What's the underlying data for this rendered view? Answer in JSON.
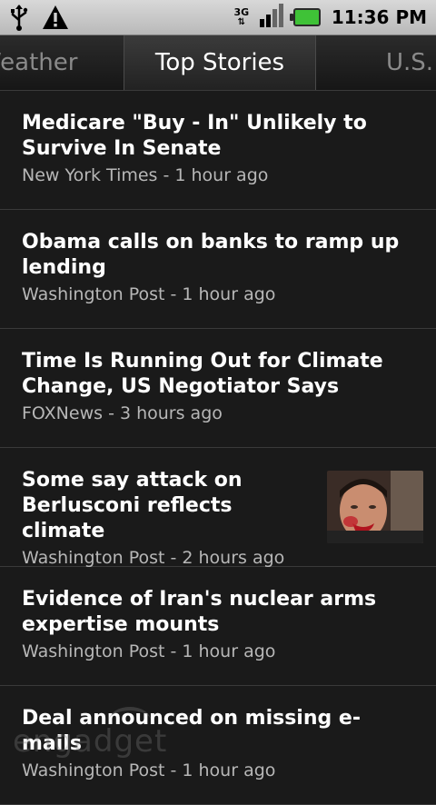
{
  "status_bar": {
    "time": "11:36 PM",
    "network": "3G",
    "icons": [
      "usb-icon",
      "warning-icon",
      "network-3g-icon",
      "signal-icon",
      "battery-icon"
    ],
    "battery_color": "#3fc237"
  },
  "tabs": [
    {
      "label": "Weather",
      "active": false
    },
    {
      "label": "Top Stories",
      "active": true
    },
    {
      "label": "U.S.",
      "active": false
    }
  ],
  "stories": [
    {
      "headline": "Medicare \"Buy - In\" Unlikely to Survive In Senate",
      "source": "New York Times",
      "age": "1 hour ago",
      "meta": "New York Times - 1 hour ago"
    },
    {
      "headline": "Obama calls on banks to ramp up lending",
      "source": "Washington Post",
      "age": "1 hour ago",
      "meta": "Washington Post - 1 hour ago"
    },
    {
      "headline": "Time Is Running Out for Climate Change, US Negotiator Says",
      "source": "FOXNews",
      "age": "3 hours ago",
      "meta": "FOXNews - 3 hours ago"
    },
    {
      "headline": "Some say attack on Berlusconi reflects climate",
      "source": "Washington Post",
      "age": "2 hours ago",
      "meta": "Washington Post - 2 hours ago",
      "has_thumbnail": true
    },
    {
      "headline": "Evidence of Iran's nuclear arms expertise mounts",
      "source": "Washington Post",
      "age": "1 hour ago",
      "meta": "Washington Post - 1 hour ago"
    },
    {
      "headline": "Deal announced on missing e-mails",
      "source": "Washington Post",
      "age": "1 hour ago",
      "meta": "Washington Post - 1 hour ago"
    }
  ],
  "watermark": "engadget"
}
